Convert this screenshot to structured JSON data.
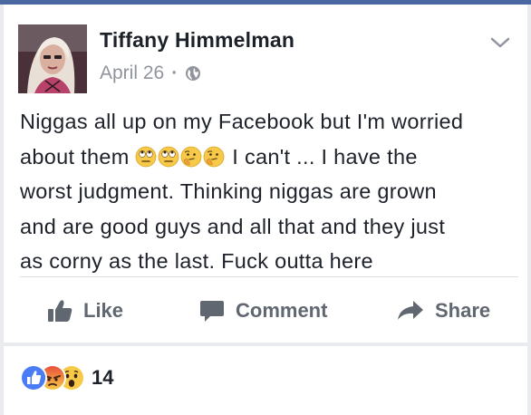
{
  "post": {
    "author": "Tiffany Himmelman",
    "date": "April 26",
    "separator": "·",
    "privacy_icon": "globe-icon",
    "text_lines": [
      "Niggas all up on my Facebook but I'm worried",
      "about them",
      "I can't ... I have the",
      "worst judgment. Thinking niggas are grown",
      "and are good guys and all that and they just",
      "as corny as the last. Fuck outta here"
    ],
    "emojis": [
      "rolling-eyes-emoji",
      "rolling-eyes-emoji",
      "thinking-face-emoji",
      "thinking-face-emoji"
    ]
  },
  "actions": {
    "like": "Like",
    "comment": "Comment",
    "share": "Share"
  },
  "reactions": {
    "types": [
      "like",
      "angry",
      "wow"
    ],
    "count": "14"
  },
  "colors": {
    "header_bar": "#4b67a1",
    "text": "#1d2129",
    "muted": "#90949c",
    "action": "#606770",
    "like_blue": "#4a7cf6",
    "angry_orange": "#f26b3a",
    "wow_yellow": "#f7c948"
  }
}
